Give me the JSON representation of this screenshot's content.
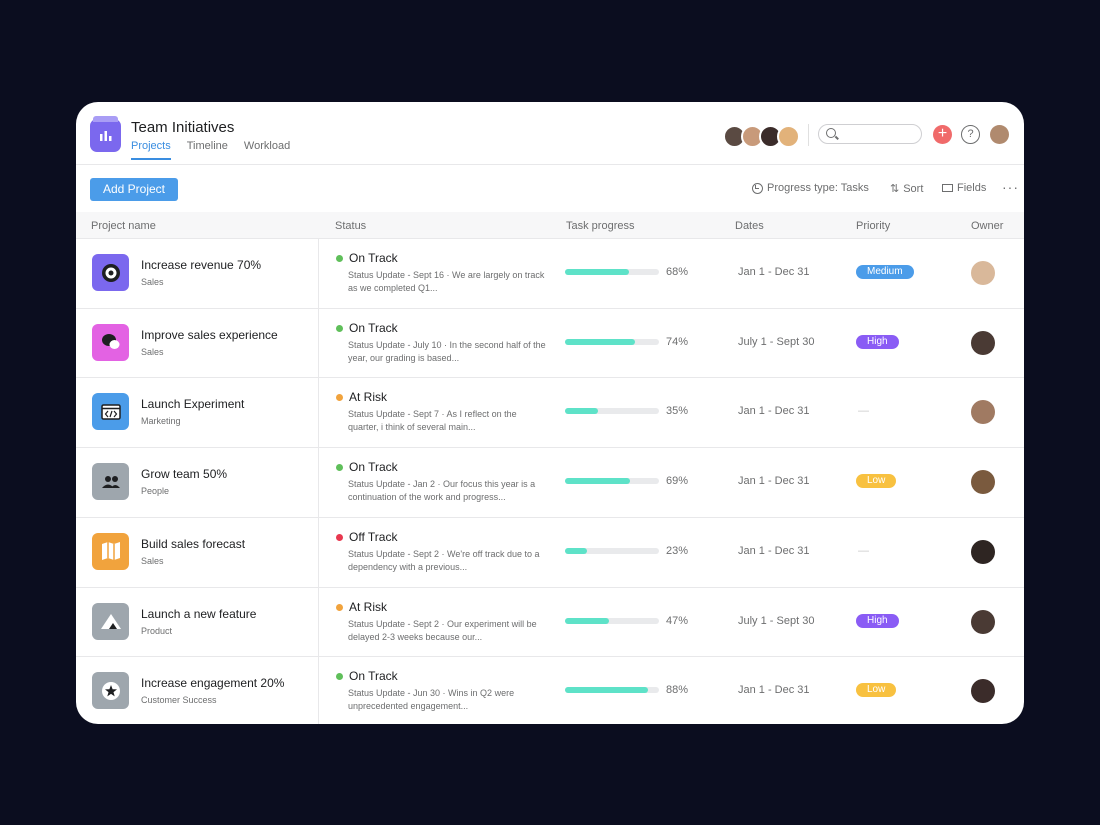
{
  "app": {
    "title": "Team Initiatives"
  },
  "tabs": [
    {
      "label": "Projects",
      "active": true
    },
    {
      "label": "Timeline",
      "active": false
    },
    {
      "label": "Workload",
      "active": false
    }
  ],
  "header": {
    "search_placeholder": "",
    "plus_label": "+",
    "help_label": "?",
    "member_avatar_colors": [
      "#5a4a42",
      "#c89a7a",
      "#3b2c2a",
      "#e2b27a"
    ]
  },
  "toolbar": {
    "add_label": "Add Project",
    "progress_type_label": "Progress type: Tasks",
    "sort_label": "Sort",
    "fields_label": "Fields",
    "more_label": "···"
  },
  "columns": {
    "name": "Project name",
    "status": "Status",
    "progress": "Task progress",
    "dates": "Dates",
    "priority": "Priority",
    "owner": "Owner"
  },
  "colors": {
    "accent": "#3a8de0",
    "on_track": "#5fbf5a",
    "at_risk": "#f1a33d",
    "off_track": "#e8384f",
    "progress_fill": "#5ee2c8"
  },
  "projects": [
    {
      "name": "Increase revenue 70%",
      "team": "Sales",
      "icon": "target-icon",
      "icon_bg": "#7b68ee",
      "status": "On Track",
      "status_color": "#5fbf5a",
      "update": "Status Update - Sept 16 · We are largely on track as we completed Q1...",
      "progress": 68,
      "progress_label": "68%",
      "dates": "Jan 1 - Dec 31",
      "priority": "Medium",
      "priority_bg": "#4b9ce9",
      "priority_fg": "#ffffff",
      "owner_color": "#d9b89a"
    },
    {
      "name": "Improve sales experience",
      "team": "Sales",
      "icon": "chat-bubbles-icon",
      "icon_bg": "#e362e3",
      "status": "On Track",
      "status_color": "#5fbf5a",
      "update": "Status Update - July 10 · In the second half of the year, our grading is based...",
      "progress": 74,
      "progress_label": "74%",
      "dates": "July 1 - Sept 30",
      "priority": "High",
      "priority_bg": "#8a5cf5",
      "priority_fg": "#ffffff",
      "owner_color": "#4a3a34"
    },
    {
      "name": "Launch Experiment",
      "team": "Marketing",
      "icon": "code-window-icon",
      "icon_bg": "#4b9ce9",
      "status": "At Risk",
      "status_color": "#f1a33d",
      "update": "Status Update - Sept 7 · As I reflect on the quarter, i think of several main...",
      "progress": 35,
      "progress_label": "35%",
      "dates": "Jan 1 - Dec 31",
      "priority": "",
      "priority_bg": "",
      "priority_fg": "",
      "owner_color": "#a07a62"
    },
    {
      "name": "Grow team 50%",
      "team": "People",
      "icon": "people-icon",
      "icon_bg": "#9ea6ad",
      "status": "On Track",
      "status_color": "#5fbf5a",
      "update": "Status Update - Jan 2 · Our focus this year is a continuation of the work and progress...",
      "progress": 69,
      "progress_label": "69%",
      "dates": "Jan 1 - Dec 31",
      "priority": "Low",
      "priority_bg": "#f8c140",
      "priority_fg": "#ffffff",
      "owner_color": "#7a5a3e"
    },
    {
      "name": "Build sales forecast",
      "team": "Sales",
      "icon": "map-icon",
      "icon_bg": "#f1a33d",
      "status": "Off Track",
      "status_color": "#e8384f",
      "update": "Status Update - Sept 2 · We're off track due to a dependency with a previous...",
      "progress": 23,
      "progress_label": "23%",
      "dates": "Jan 1 - Dec 31",
      "priority": "",
      "priority_bg": "",
      "priority_fg": "",
      "owner_color": "#2e2522"
    },
    {
      "name": "Launch a new feature",
      "team": "Product",
      "icon": "mountain-icon",
      "icon_bg": "#9ea6ad",
      "status": "At Risk",
      "status_color": "#f1a33d",
      "update": "Status Update - Sept 2 · Our experiment will be delayed 2-3 weeks because our...",
      "progress": 47,
      "progress_label": "47%",
      "dates": "July 1 - Sept 30",
      "priority": "High",
      "priority_bg": "#8a5cf5",
      "priority_fg": "#ffffff",
      "owner_color": "#4a3a34"
    },
    {
      "name": "Increase engagement 20%",
      "team": "Customer Success",
      "icon": "star-icon",
      "icon_bg": "#9ea6ad",
      "status": "On Track",
      "status_color": "#5fbf5a",
      "update": "Status Update - Jun 30 · Wins in Q2 were unprecedented engagement...",
      "progress": 88,
      "progress_label": "88%",
      "dates": "Jan 1 - Dec 31",
      "priority": "Low",
      "priority_bg": "#f8c140",
      "priority_fg": "#ffffff",
      "owner_color": "#3b2c2a"
    }
  ]
}
